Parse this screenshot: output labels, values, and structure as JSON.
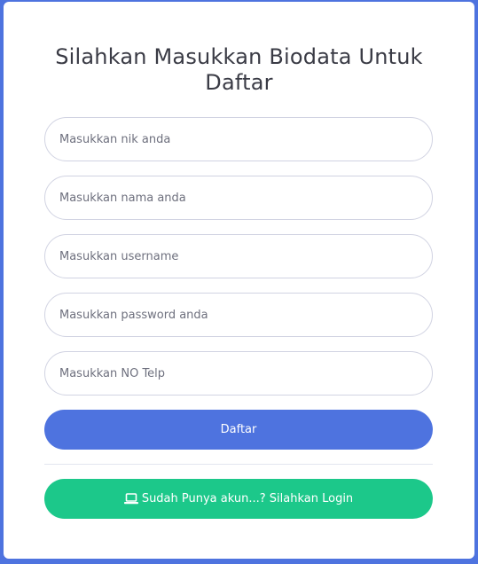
{
  "page": {
    "title_line1": "Silahkan Masukkan Biodata Untuk",
    "title_line2": "Daftar"
  },
  "form": {
    "nik_placeholder": "Masukkan nik anda",
    "nama_placeholder": "Masukkan nama anda",
    "username_placeholder": "Masukkan username",
    "password_placeholder": "Masukkan password anda",
    "telp_placeholder": "Masukkan NO Telp",
    "submit_label": "Daftar",
    "login_label": "Sudah Punya akun...? Silahkan Login",
    "login_icon": "laptop-icon"
  },
  "colors": {
    "background": "#4e73df",
    "primary": "#4e73df",
    "success": "#1cc88a"
  }
}
